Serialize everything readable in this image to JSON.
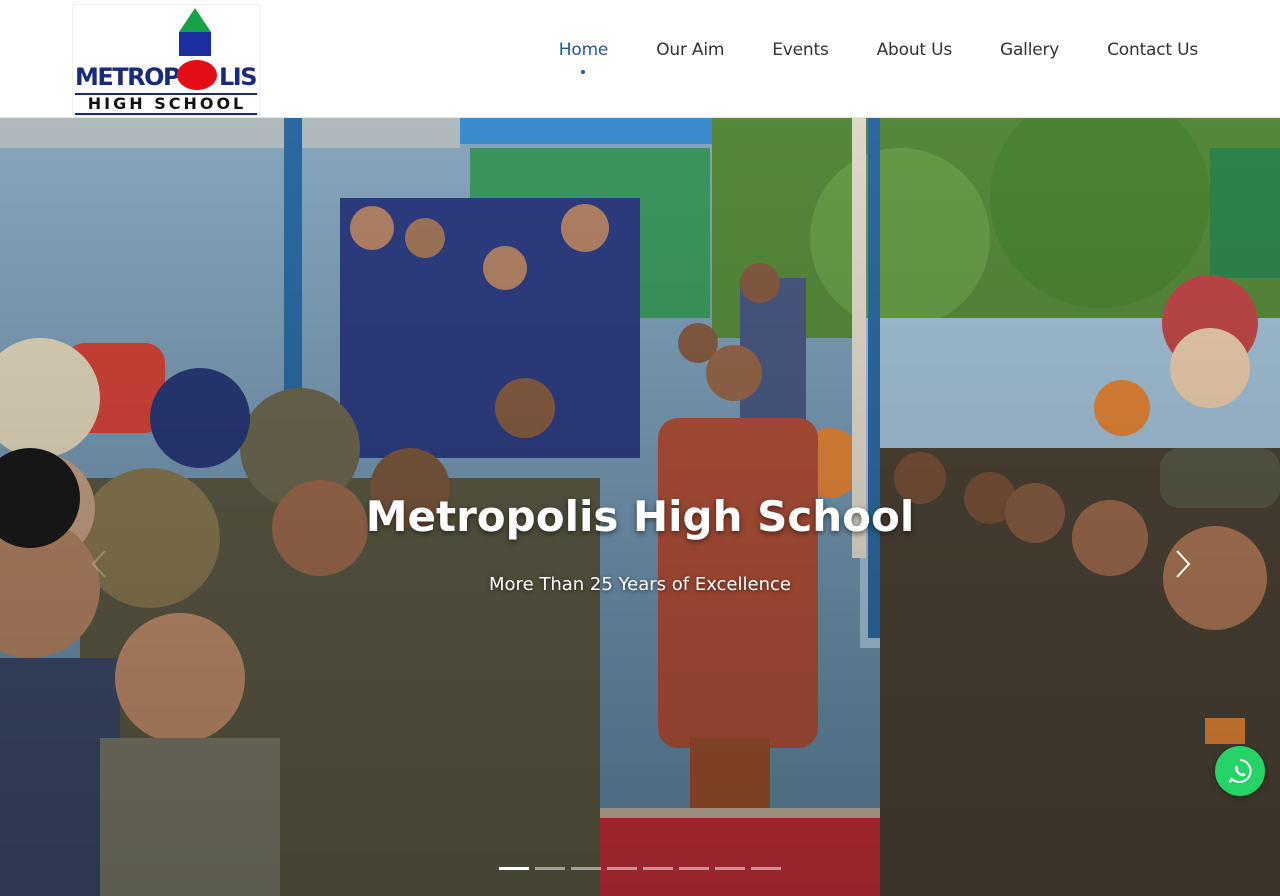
{
  "logo": {
    "word_left": "METROP",
    "word_right": "LIS",
    "subtitle": "HIGH SCHOOL"
  },
  "nav": {
    "items": [
      {
        "label": "Home",
        "active": true
      },
      {
        "label": "Our Aim",
        "active": false
      },
      {
        "label": "Events",
        "active": false
      },
      {
        "label": "About Us",
        "active": false
      },
      {
        "label": "Gallery",
        "active": false
      },
      {
        "label": "Contact Us",
        "active": false
      }
    ]
  },
  "hero": {
    "title": "Metropolis High School",
    "subtitle": "More Than 25 Years of Excellence",
    "slide_count": 8,
    "active_slide": 1,
    "prev_icon": "chevron-left-icon",
    "next_icon": "chevron-right-icon"
  },
  "whatsapp": {
    "icon": "whatsapp-icon"
  },
  "colors": {
    "nav_active": "#2355a5",
    "nav_text": "#333333",
    "logo_blue": "#182a7a",
    "logo_red": "#e40d16",
    "logo_green": "#16a348",
    "whatsapp_green": "#25d366"
  }
}
